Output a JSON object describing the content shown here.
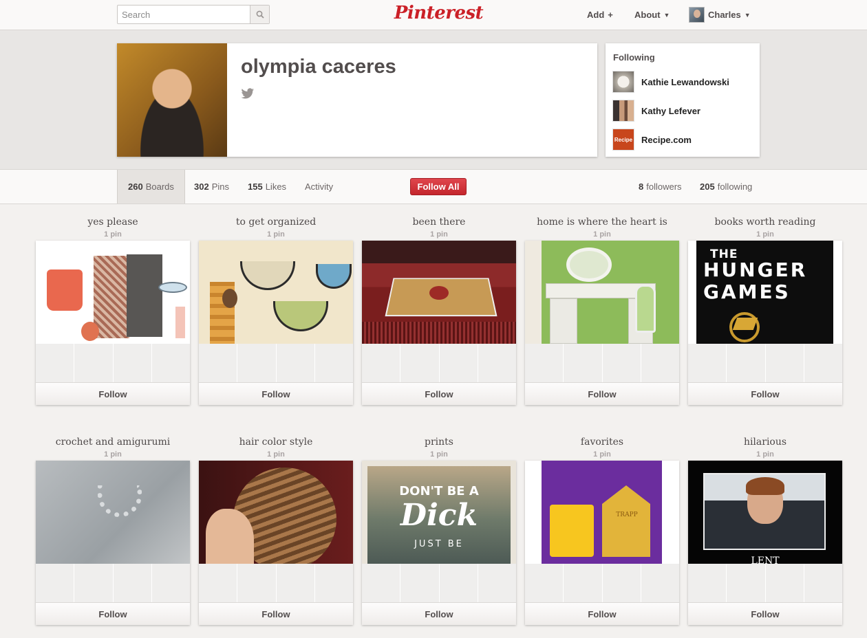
{
  "header": {
    "search_placeholder": "Search",
    "logo": "Pinterest",
    "nav": {
      "add": "Add",
      "about": "About",
      "user": "Charles"
    }
  },
  "profile": {
    "name": "olympia caceres"
  },
  "following_box": {
    "title": "Following",
    "people": [
      {
        "name": "Kathie Lewandowski"
      },
      {
        "name": "Kathy Lefever"
      },
      {
        "name": "Recipe.com",
        "avatar_text": "Recipe"
      }
    ]
  },
  "stats": {
    "boards_count": "260",
    "boards_label": "Boards",
    "pins_count": "302",
    "pins_label": "Pins",
    "likes_count": "155",
    "likes_label": "Likes",
    "activity_label": "Activity",
    "follow_all": "Follow All",
    "followers_count": "8",
    "followers_label": "followers",
    "following_count": "205",
    "following_label": "following"
  },
  "boards": [
    {
      "title": "yes please",
      "count": "1 pin",
      "follow": "Follow"
    },
    {
      "title": "to get organized",
      "count": "1 pin",
      "follow": "Follow"
    },
    {
      "title": "been there",
      "count": "1 pin",
      "follow": "Follow"
    },
    {
      "title": "home is where the heart is",
      "count": "1 pin",
      "follow": "Follow"
    },
    {
      "title": "books worth reading",
      "count": "1 pin",
      "follow": "Follow",
      "cover_text": [
        "THE",
        "HUNGER",
        "GAMES"
      ]
    },
    {
      "title": "crochet and amigurumi",
      "count": "1 pin",
      "follow": "Follow"
    },
    {
      "title": "hair color style",
      "count": "1 pin",
      "follow": "Follow"
    },
    {
      "title": "prints",
      "count": "1 pin",
      "follow": "Follow",
      "cover_text": [
        "DON'T BE A",
        "Dick",
        "JUST BE"
      ]
    },
    {
      "title": "favorites",
      "count": "1 pin",
      "follow": "Follow",
      "cover_text": [
        "TRAPP"
      ]
    },
    {
      "title": "hilarious",
      "count": "1 pin",
      "follow": "Follow",
      "cover_text": [
        "LENT"
      ]
    }
  ]
}
